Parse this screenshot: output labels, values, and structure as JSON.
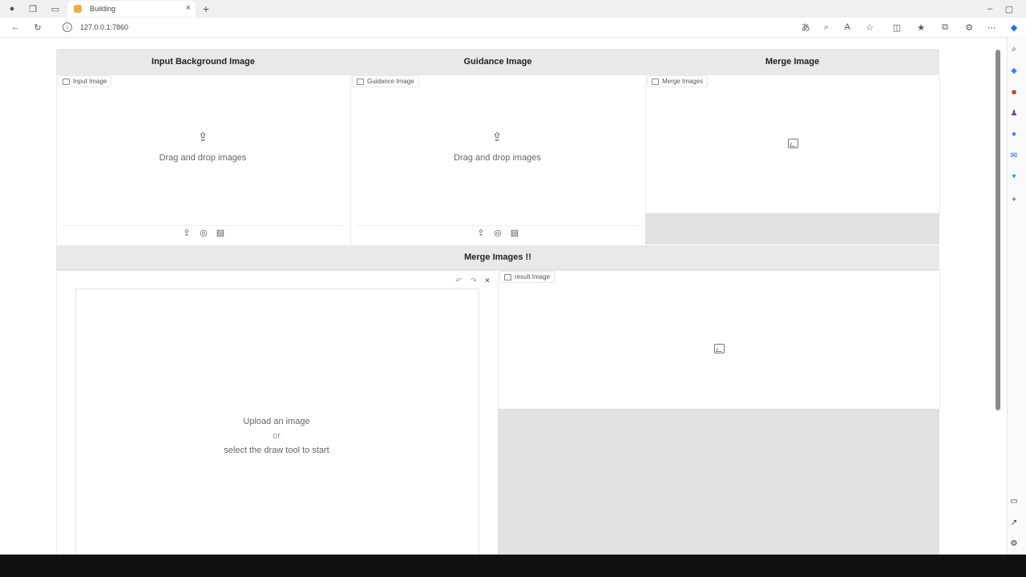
{
  "browser": {
    "tab_title": "Building",
    "url": "127.0.0.1:7860",
    "tab_close": "×",
    "new_tab": "+"
  },
  "headers": {
    "input_background": "Input Background Image",
    "guidance": "Guidance Image",
    "merge_image": "Merge Image",
    "merge_images_button": "Merge Images !!"
  },
  "labels": {
    "input_image": "Input Image",
    "guidance_image": "Guidance Image",
    "merge_images": "Merge Images",
    "result_image": "result Image"
  },
  "upload": {
    "drag_drop_1": "Drag and drop images",
    "drag_drop_2": "Drag and drop images"
  },
  "editor": {
    "line1": "Upload an image",
    "line2": "or",
    "line3": "select the draw tool to start"
  },
  "colors": {
    "header_bg": "#e9e9e9",
    "empty_area": "#e2e2e2",
    "taskbar": "#111111",
    "accent": "#e9b04a"
  }
}
